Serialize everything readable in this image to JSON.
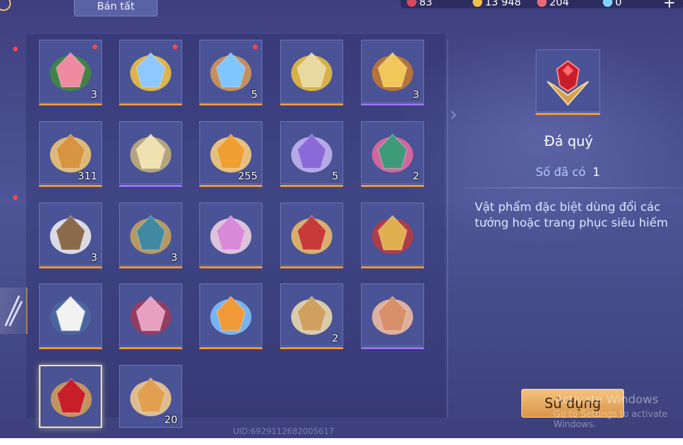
{
  "topbar": {
    "sell_all_label": "Bán tất",
    "currencies": [
      {
        "icon": "ruby-icon",
        "value": "83"
      },
      {
        "icon": "gold-coin-icon",
        "value": "13 948"
      },
      {
        "icon": "gem-icon",
        "value": "204"
      },
      {
        "icon": "crystal-icon",
        "value": "0"
      }
    ],
    "add_label": "+"
  },
  "items": [
    {
      "name": "roses",
      "count": "3",
      "rarity": "orange",
      "dot": true
    },
    {
      "name": "toy-blaster",
      "count": "",
      "rarity": "orange",
      "dot": true
    },
    {
      "name": "hero-card",
      "count": "5",
      "rarity": "orange",
      "dot": true
    },
    {
      "name": "star-ticket",
      "count": "",
      "rarity": "orange",
      "dot": false
    },
    {
      "name": "trumpet",
      "count": "3",
      "rarity": "purple",
      "dot": false
    },
    {
      "name": "golden-armor",
      "count": "311",
      "rarity": "orange",
      "dot": false
    },
    {
      "name": "crystal-orb",
      "count": "",
      "rarity": "purple",
      "dot": false
    },
    {
      "name": "anniversary-ticket",
      "count": "255",
      "rarity": "orange",
      "dot": false
    },
    {
      "name": "knight-helmet",
      "count": "5",
      "rarity": "orange",
      "dot": false
    },
    {
      "name": "green-emblem",
      "count": "2",
      "rarity": "orange",
      "dot": false
    },
    {
      "name": "ghost-card",
      "count": "3",
      "rarity": "orange",
      "dot": false
    },
    {
      "name": "scroll-map",
      "count": "3",
      "rarity": "orange",
      "dot": false
    },
    {
      "name": "fairy-figure",
      "count": "",
      "rarity": "orange",
      "dot": false
    },
    {
      "name": "magic-planet",
      "count": "",
      "rarity": "orange",
      "dot": false
    },
    {
      "name": "golden-trophy",
      "count": "",
      "rarity": "orange",
      "dot": false
    },
    {
      "name": "costume-outfit",
      "count": "",
      "rarity": "orange",
      "dot": false
    },
    {
      "name": "bat-pet",
      "count": "",
      "rarity": "orange",
      "dot": false
    },
    {
      "name": "fruit-cup",
      "count": "",
      "rarity": "orange",
      "dot": false
    },
    {
      "name": "rolled-scroll",
      "count": "2",
      "rarity": "orange",
      "dot": false
    },
    {
      "name": "amber-shard",
      "count": "",
      "rarity": "purple",
      "dot": false
    },
    {
      "name": "precious-gem",
      "count": "",
      "rarity": "none",
      "dot": false,
      "selected": true
    },
    {
      "name": "hero-portrait",
      "count": "20",
      "rarity": "none",
      "dot": false
    }
  ],
  "detail": {
    "name": "Đá quý",
    "owned_label": "Số đã có",
    "owned_value": "1",
    "description": "Vật phẩm đặc biệt dùng đổi các tướng hoặc trang phục siêu hiếm",
    "use_label": "Sử dụng"
  },
  "watermark": {
    "line1": "Activate Windows",
    "line2": "Go to Settings to activate Windows."
  },
  "uid": "UID:6929112682005617",
  "colors": {
    "orange_rarity": "#f09a38",
    "purple_rarity": "#9b72ff",
    "button": "#e8a85e"
  }
}
